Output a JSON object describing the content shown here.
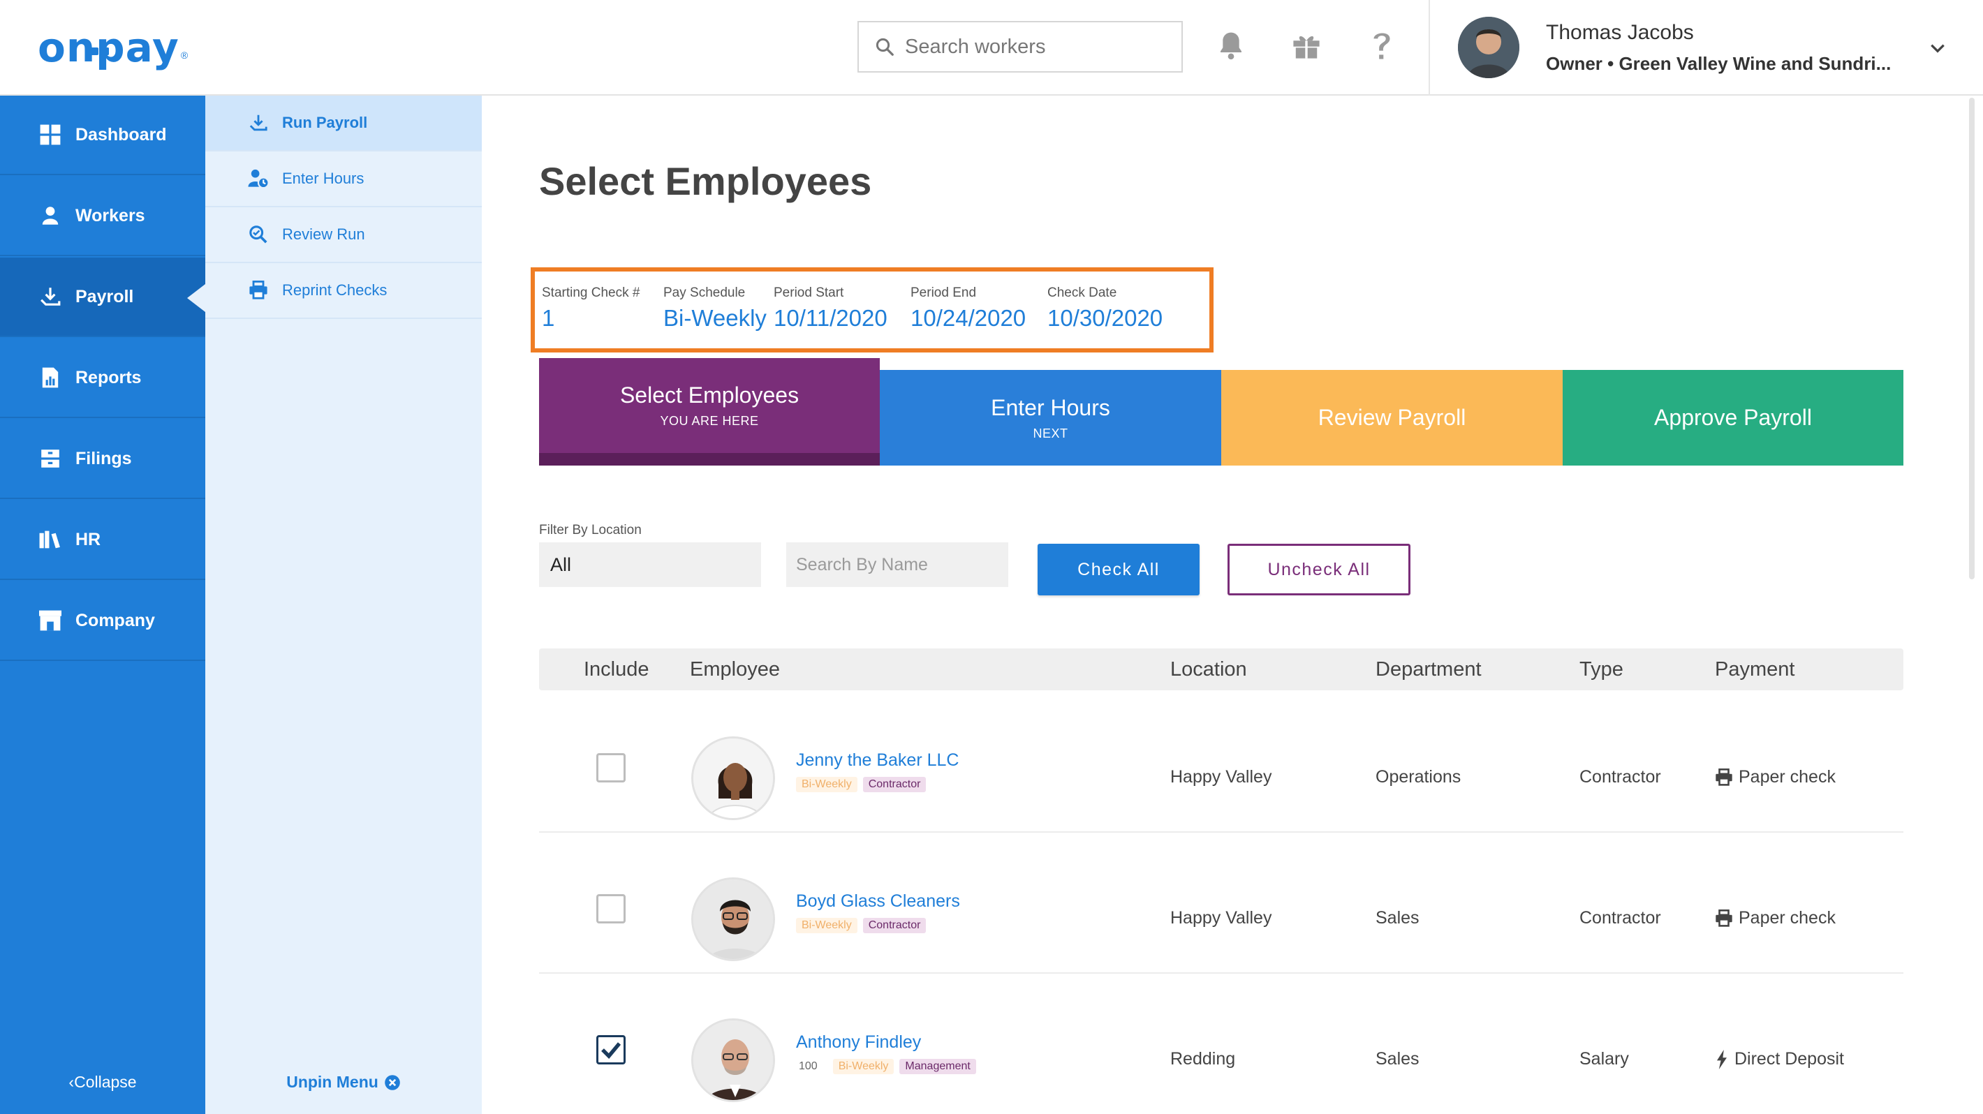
{
  "brand": {
    "logo_text": "onpay",
    "logo_mark": "®",
    "accent": "#1f7ed8",
    "purple": "#7a2e79",
    "orange_highlight": "#ef7d24"
  },
  "header": {
    "search_placeholder": "Search workers",
    "icons": [
      "bell-icon",
      "gift-icon",
      "help-icon"
    ],
    "user": {
      "name": "Thomas Jacobs",
      "role": "Owner • Green Valley Wine and Sundri..."
    }
  },
  "sidebar": {
    "items": [
      {
        "label": "Dashboard",
        "icon": "dashboard-icon"
      },
      {
        "label": "Workers",
        "icon": "workers-icon"
      },
      {
        "label": "Payroll",
        "icon": "payroll-icon",
        "active": true
      },
      {
        "label": "Reports",
        "icon": "reports-icon"
      },
      {
        "label": "Filings",
        "icon": "filings-icon"
      },
      {
        "label": "HR",
        "icon": "hr-icon"
      },
      {
        "label": "Company",
        "icon": "company-icon"
      }
    ],
    "collapse_label": "Collapse"
  },
  "submenu": {
    "items": [
      {
        "label": "Run Payroll",
        "icon": "run-payroll-icon",
        "active": true
      },
      {
        "label": "Enter Hours",
        "icon": "enter-hours-icon"
      },
      {
        "label": "Review Run",
        "icon": "review-run-icon"
      },
      {
        "label": "Reprint Checks",
        "icon": "printer-icon"
      }
    ],
    "unpin_label": "Unpin Menu"
  },
  "main": {
    "title": "Select Employees",
    "schedule": {
      "starting_check_label": "Starting Check #",
      "starting_check_value": "1",
      "pay_schedule_label": "Pay Schedule",
      "pay_schedule_value": "Bi-Weekly",
      "period_start_label": "Period Start",
      "period_start_value": "10/11/2020",
      "period_end_label": "Period End",
      "period_end_value": "10/24/2020",
      "check_date_label": "Check Date",
      "check_date_value": "10/30/2020"
    },
    "steps": [
      {
        "title": "Select Employees",
        "subtitle": "YOU ARE HERE",
        "color": "#7a2e79"
      },
      {
        "title": "Enter Hours",
        "subtitle": "NEXT",
        "color": "#2a7fd9"
      },
      {
        "title": "Review Payroll",
        "subtitle": "",
        "color": "#fbb957"
      },
      {
        "title": "Approve Payroll",
        "subtitle": "",
        "color": "#27ad82"
      }
    ],
    "filter": {
      "label": "Filter By Location",
      "location_value": "All",
      "name_placeholder": "Search By Name",
      "check_all": "Check All",
      "uncheck_all": "Uncheck All"
    },
    "table": {
      "headers": [
        "Include",
        "Employee",
        "Location",
        "Department",
        "Type",
        "Payment"
      ],
      "rows": [
        {
          "checked": false,
          "name": "Jenny the Baker LLC",
          "number": "",
          "schedule_tag": "Bi-Weekly",
          "type_tag": "Contractor",
          "location": "Happy Valley",
          "department": "Operations",
          "type": "Contractor",
          "payment": "Paper check",
          "payment_icon": "printer-icon"
        },
        {
          "checked": false,
          "name": "Boyd Glass Cleaners",
          "number": "",
          "schedule_tag": "Bi-Weekly",
          "type_tag": "Contractor",
          "location": "Happy Valley",
          "department": "Sales",
          "type": "Contractor",
          "payment": "Paper check",
          "payment_icon": "printer-icon"
        },
        {
          "checked": true,
          "name": "Anthony Findley",
          "number": "100",
          "schedule_tag": "Bi-Weekly",
          "type_tag": "Management",
          "location": "Redding",
          "department": "Sales",
          "type": "Salary",
          "payment": "Direct Deposit",
          "payment_icon": "bolt-icon"
        }
      ]
    }
  }
}
